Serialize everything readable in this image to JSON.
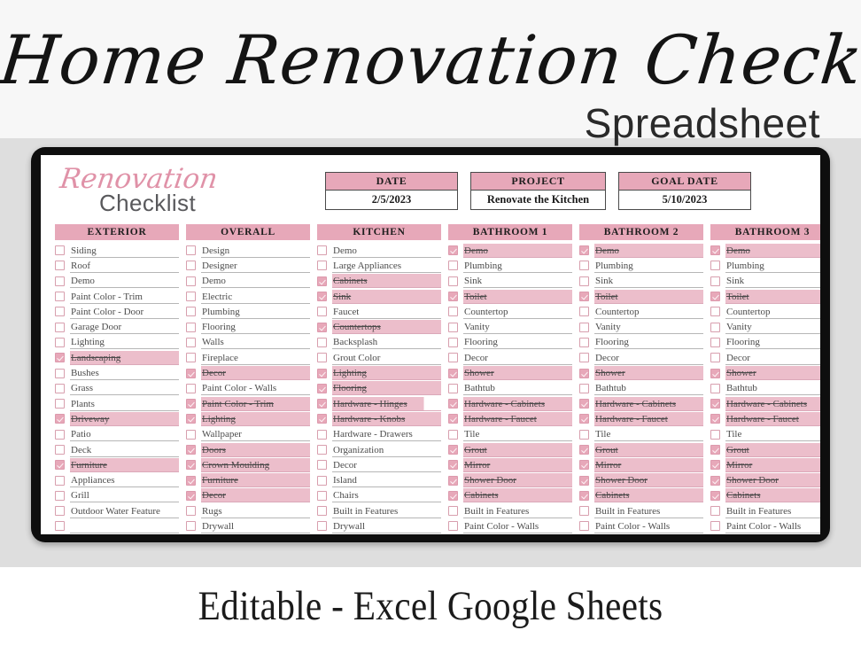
{
  "hero": {
    "title": "Home Renovation Checklist",
    "subtitle": "Spreadsheet"
  },
  "footer": {
    "text": "Editable - Excel Google Sheets"
  },
  "colors": {
    "accent_pink": "#e7a8b9",
    "row_highlight": "#ecbecb",
    "frame": "#0e0e0e",
    "background": "#dedede",
    "label_text": "#4b4b4b"
  },
  "sheet": {
    "logo": {
      "script": "Renovation",
      "sub": "Checklist"
    },
    "info_boxes": [
      {
        "label": "DATE",
        "value": "2/5/2023"
      },
      {
        "label": "PROJECT",
        "value": "Renovate the Kitchen"
      },
      {
        "label": "GOAL DATE",
        "value": "5/10/2023"
      }
    ],
    "columns": [
      {
        "header": "EXTERIOR",
        "rows": [
          {
            "label": "Siding",
            "checked": false
          },
          {
            "label": "Roof",
            "checked": false
          },
          {
            "label": "Demo",
            "checked": false
          },
          {
            "label": "Paint Color - Trim",
            "checked": false
          },
          {
            "label": "Paint Color - Door",
            "checked": false
          },
          {
            "label": "Garage Door",
            "checked": false
          },
          {
            "label": "Lighting",
            "checked": false
          },
          {
            "label": "Landscaping",
            "checked": true
          },
          {
            "label": "Bushes",
            "checked": false
          },
          {
            "label": "Grass",
            "checked": false
          },
          {
            "label": "Plants",
            "checked": false
          },
          {
            "label": "Driveway",
            "checked": true
          },
          {
            "label": "Patio",
            "checked": false
          },
          {
            "label": "Deck",
            "checked": false
          },
          {
            "label": "Furniture",
            "checked": true
          },
          {
            "label": "Appliances",
            "checked": false
          },
          {
            "label": "Grill",
            "checked": false
          },
          {
            "label": "Outdoor Water Feature",
            "checked": false
          },
          {
            "label": "",
            "checked": false
          }
        ]
      },
      {
        "header": "OVERALL",
        "rows": [
          {
            "label": "Design",
            "checked": false
          },
          {
            "label": "Designer",
            "checked": false
          },
          {
            "label": "Demo",
            "checked": false
          },
          {
            "label": "Electric",
            "checked": false
          },
          {
            "label": "Plumbing",
            "checked": false
          },
          {
            "label": "Flooring",
            "checked": false
          },
          {
            "label": "Walls",
            "checked": false
          },
          {
            "label": "Fireplace",
            "checked": false
          },
          {
            "label": "Decor",
            "checked": true
          },
          {
            "label": "Paint Color - Walls",
            "checked": false
          },
          {
            "label": "Paint Color - Trim",
            "checked": true
          },
          {
            "label": "Lighting",
            "checked": true
          },
          {
            "label": "Wallpaper",
            "checked": false
          },
          {
            "label": "Doors",
            "checked": true
          },
          {
            "label": "Crown Moulding",
            "checked": true
          },
          {
            "label": "Furniture",
            "checked": true
          },
          {
            "label": "Decor",
            "checked": true
          },
          {
            "label": "Rugs",
            "checked": false
          },
          {
            "label": "Drywall",
            "checked": false
          }
        ]
      },
      {
        "header": "KITCHEN",
        "rows": [
          {
            "label": "Demo",
            "checked": false
          },
          {
            "label": "Large Appliances",
            "checked": false
          },
          {
            "label": "Cabinets",
            "checked": true
          },
          {
            "label": "Sink",
            "checked": true
          },
          {
            "label": "Faucet",
            "checked": false
          },
          {
            "label": "Countertops",
            "checked": true
          },
          {
            "label": "Backsplash",
            "checked": false
          },
          {
            "label": "Grout Color",
            "checked": false
          },
          {
            "label": "Lighting",
            "checked": true
          },
          {
            "label": "Flooring",
            "checked": true
          },
          {
            "label": "Hardware - Hinges",
            "checked": true,
            "short": true
          },
          {
            "label": "Hardware - Knobs",
            "checked": true
          },
          {
            "label": "Hardware - Drawers",
            "checked": false
          },
          {
            "label": "Organization",
            "checked": false
          },
          {
            "label": "Decor",
            "checked": false
          },
          {
            "label": "Island",
            "checked": false
          },
          {
            "label": "Chairs",
            "checked": false
          },
          {
            "label": "Built in Features",
            "checked": false
          },
          {
            "label": "Drywall",
            "checked": false
          }
        ]
      },
      {
        "header": "BATHROOM 1",
        "rows": [
          {
            "label": "Demo",
            "checked": true
          },
          {
            "label": "Plumbing",
            "checked": false
          },
          {
            "label": "Sink",
            "checked": false
          },
          {
            "label": "Toilet",
            "checked": true
          },
          {
            "label": "Countertop",
            "checked": false
          },
          {
            "label": "Vanity",
            "checked": false
          },
          {
            "label": "Flooring",
            "checked": false
          },
          {
            "label": "Decor",
            "checked": false
          },
          {
            "label": "Shower",
            "checked": true
          },
          {
            "label": "Bathtub",
            "checked": false
          },
          {
            "label": "Hardware - Cabinets",
            "checked": true
          },
          {
            "label": "Hardware - Faucet",
            "checked": true
          },
          {
            "label": "Tile",
            "checked": false
          },
          {
            "label": "Grout",
            "checked": true
          },
          {
            "label": "Mirror",
            "checked": true
          },
          {
            "label": "Shower Door",
            "checked": true
          },
          {
            "label": "Cabinets",
            "checked": true
          },
          {
            "label": "Built in Features",
            "checked": false
          },
          {
            "label": "Paint Color - Walls",
            "checked": false
          }
        ]
      },
      {
        "header": "BATHROOM 2",
        "rows": [
          {
            "label": "Demo",
            "checked": true
          },
          {
            "label": "Plumbing",
            "checked": false
          },
          {
            "label": "Sink",
            "checked": false
          },
          {
            "label": "Toilet",
            "checked": true
          },
          {
            "label": "Countertop",
            "checked": false
          },
          {
            "label": "Vanity",
            "checked": false
          },
          {
            "label": "Flooring",
            "checked": false
          },
          {
            "label": "Decor",
            "checked": false
          },
          {
            "label": "Shower",
            "checked": true
          },
          {
            "label": "Bathtub",
            "checked": false
          },
          {
            "label": "Hardware - Cabinets",
            "checked": true
          },
          {
            "label": "Hardware - Faucet",
            "checked": true
          },
          {
            "label": "Tile",
            "checked": false
          },
          {
            "label": "Grout",
            "checked": true
          },
          {
            "label": "Mirror",
            "checked": true
          },
          {
            "label": "Shower Door",
            "checked": true
          },
          {
            "label": "Cabinets",
            "checked": true
          },
          {
            "label": "Built in Features",
            "checked": false
          },
          {
            "label": "Paint Color - Walls",
            "checked": false
          }
        ]
      },
      {
        "header": "BATHROOM 3",
        "rows": [
          {
            "label": "Demo",
            "checked": true
          },
          {
            "label": "Plumbing",
            "checked": false
          },
          {
            "label": "Sink",
            "checked": false
          },
          {
            "label": "Toilet",
            "checked": true
          },
          {
            "label": "Countertop",
            "checked": false
          },
          {
            "label": "Vanity",
            "checked": false
          },
          {
            "label": "Flooring",
            "checked": false
          },
          {
            "label": "Decor",
            "checked": false
          },
          {
            "label": "Shower",
            "checked": true
          },
          {
            "label": "Bathtub",
            "checked": false
          },
          {
            "label": "Hardware - Cabinets",
            "checked": true
          },
          {
            "label": "Hardware - Faucet",
            "checked": true
          },
          {
            "label": "Tile",
            "checked": false
          },
          {
            "label": "Grout",
            "checked": true
          },
          {
            "label": "Mirror",
            "checked": true
          },
          {
            "label": "Shower Door",
            "checked": true
          },
          {
            "label": "Cabinets",
            "checked": true
          },
          {
            "label": "Built in Features",
            "checked": false
          },
          {
            "label": "Paint Color - Walls",
            "checked": false
          }
        ]
      }
    ]
  }
}
